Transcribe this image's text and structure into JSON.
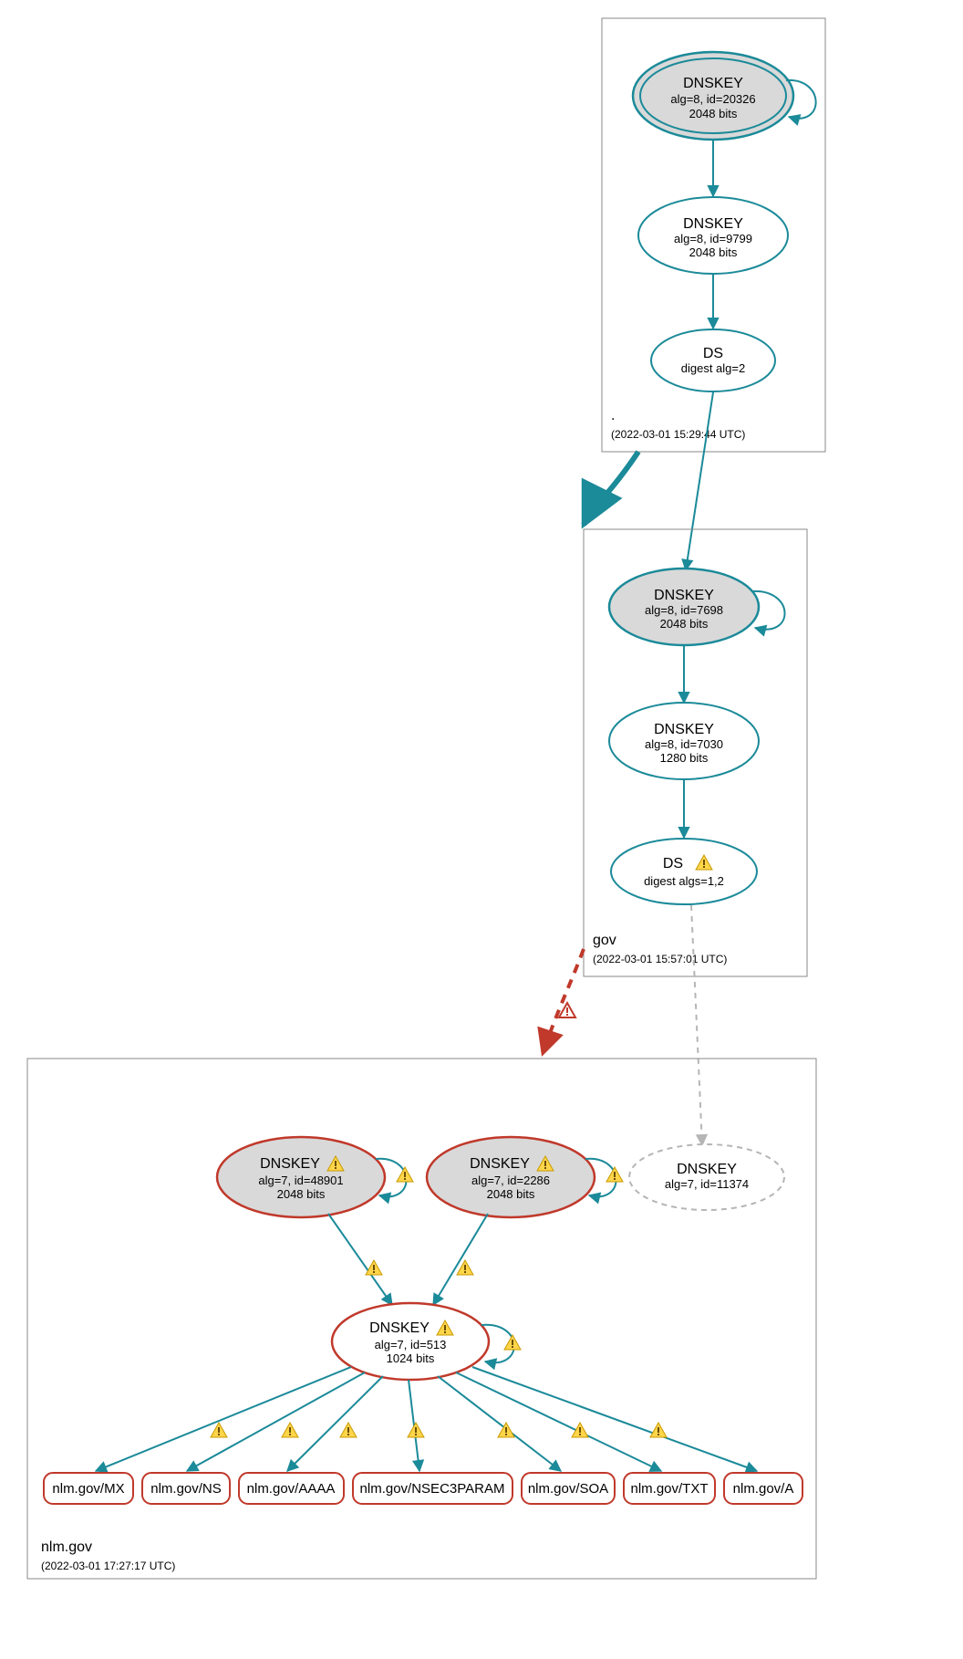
{
  "colors": {
    "teal": "#1b8a99",
    "red": "#c0392b",
    "warnRed": "#c0392b",
    "nodeGray": "#d9d9d9",
    "boxGray": "#8a8a8a",
    "dashGray": "#b5b5b5"
  },
  "zones": {
    "root": {
      "label": ".",
      "time": "(2022-03-01 15:29:44 UTC)",
      "nodes": {
        "ksk": {
          "title": "DNSKEY",
          "line1": "alg=8, id=20326",
          "line2": "2048 bits"
        },
        "zsk": {
          "title": "DNSKEY",
          "line1": "alg=8, id=9799",
          "line2": "2048 bits"
        },
        "ds": {
          "title": "DS",
          "line1": "digest alg=2"
        }
      }
    },
    "gov": {
      "label": "gov",
      "time": "(2022-03-01 15:57:01 UTC)",
      "nodes": {
        "ksk": {
          "title": "DNSKEY",
          "line1": "alg=8, id=7698",
          "line2": "2048 bits"
        },
        "zsk": {
          "title": "DNSKEY",
          "line1": "alg=8, id=7030",
          "line2": "1280 bits"
        },
        "ds": {
          "title": "DS",
          "line1": "digest algs=1,2"
        }
      }
    },
    "nlm": {
      "label": "nlm.gov",
      "time": "(2022-03-01 17:27:17 UTC)",
      "nodes": {
        "ksk1": {
          "title": "DNSKEY",
          "line1": "alg=7, id=48901",
          "line2": "2048 bits"
        },
        "ksk2": {
          "title": "DNSKEY",
          "line1": "alg=7, id=2286",
          "line2": "2048 bits"
        },
        "ghost": {
          "title": "DNSKEY",
          "line1": "alg=7, id=11374"
        },
        "zsk": {
          "title": "DNSKEY",
          "line1": "alg=7, id=513",
          "line2": "1024 bits"
        }
      },
      "rrs": {
        "mx": "nlm.gov/MX",
        "ns": "nlm.gov/NS",
        "aaaa": "nlm.gov/AAAA",
        "nsec3": "nlm.gov/NSEC3PARAM",
        "soa": "nlm.gov/SOA",
        "txt": "nlm.gov/TXT",
        "a": "nlm.gov/A"
      }
    }
  }
}
